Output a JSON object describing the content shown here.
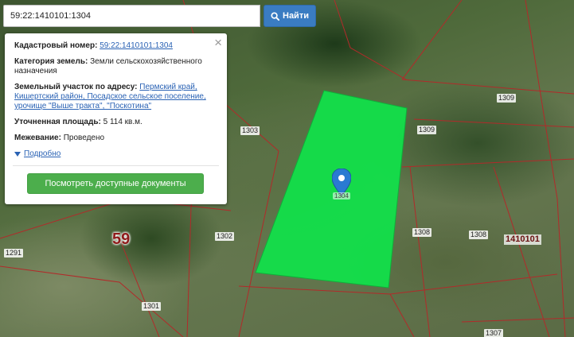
{
  "search": {
    "value": "59:22:1410101:1304",
    "button_label": "Найти"
  },
  "info": {
    "cadastral_label": "Кадастровый номер:",
    "cadastral_value": "59:22:1410101:1304",
    "category_label": "Категория земель:",
    "category_value": "Земли сельскохозяйственного назначения",
    "address_label": "Земельный участок по адресу:",
    "address_value": "Пермский край, Кишертский район, Посадское сельское поселение, урочище \"Выше тракта\", \"Поскотина\"",
    "area_label": "Уточненная площадь:",
    "area_value": "5 114 кв.м.",
    "survey_label": "Межевание:",
    "survey_value": "Проведено",
    "details_link": "Подробно",
    "docs_button": "Посмотреть доступные документы",
    "close_symbol": "×"
  },
  "map": {
    "district_number": "59",
    "quarter_number": "1410101",
    "marker_label": "1304",
    "parcel_labels": {
      "p1309_top": "1309",
      "p1309": "1309",
      "p1303": "1303",
      "p1302": "1302",
      "p1308_a": "1308",
      "p1308_b": "1308",
      "p1291": "1291",
      "p1301": "1301",
      "p1307": "1307"
    },
    "colors": {
      "selected_parcel": "#12e04a",
      "boundary": "#b22a2a",
      "marker": "#2a7ad2",
      "docs_button": "#4cae4c",
      "search_button": "#3a7cc2"
    }
  }
}
